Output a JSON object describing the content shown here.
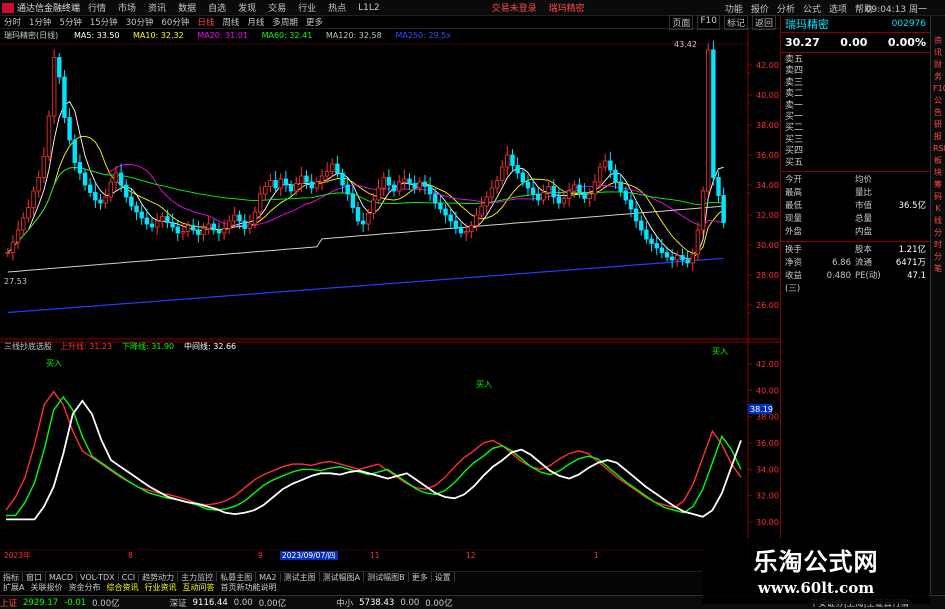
{
  "menubar": {
    "app_title": "通达信金融终端",
    "items": [
      "行情",
      "市场",
      "资讯",
      "数据",
      "自选",
      "发现",
      "交易",
      "行业",
      "热点",
      "L1L2"
    ],
    "center_items": [
      "交易未登录",
      "瑞玛精密"
    ],
    "right_items": [
      "功能",
      "报价",
      "分析",
      "公式",
      "选项",
      "帮助",
      "09:04:13 周一"
    ]
  },
  "toolbar": {
    "periods": [
      "分时",
      "1分钟",
      "5分钟",
      "15分钟",
      "30分钟",
      "60分钟",
      "日线",
      "周线",
      "月线",
      "多周期",
      "更多"
    ],
    "active_period": "日线",
    "right_buttons": [
      "页面",
      "F10",
      "标记",
      "返回"
    ]
  },
  "main_chart": {
    "title": "瑞玛精密(日线)",
    "ma_legend": [
      {
        "label": "MA5: 33.50",
        "color": "#ffffff"
      },
      {
        "label": "MA10: 32.32",
        "color": "#ffff00"
      },
      {
        "label": "MA20: 31.01",
        "color": "#ff00ff"
      },
      {
        "label": "MA60: 32.41",
        "color": "#00ff00"
      },
      {
        "label": "MA120: 32.58",
        "color": "#c0c0c0"
      },
      {
        "label": "MA250: 29.5x",
        "color": "#3050ff"
      }
    ],
    "y_ticks": [
      "42.00",
      "40.00",
      "38.00",
      "36.00",
      "34.00",
      "32.00",
      "30.00",
      "28.00",
      "26.00"
    ],
    "high_label": "43.42",
    "low_label": "27.53"
  },
  "sub_chart": {
    "title": "三线抄底选股",
    "legend": [
      {
        "label": "上升线: 31.23",
        "color": "#ff3030"
      },
      {
        "label": "下降线: 31.90",
        "color": "#00ff00"
      },
      {
        "label": "中间线: 32.66",
        "color": "#ffffff"
      }
    ],
    "y_ticks": [
      "42.00",
      "40.00",
      "38.00",
      "36.00",
      "34.00",
      "32.00",
      "30.00"
    ],
    "current_value": "38.19",
    "signal_labels": [
      "买入",
      "买入",
      "买入"
    ],
    "date_labels": [
      "2023年",
      "8",
      "9",
      "2023/09/07/四",
      "11",
      "12",
      "1"
    ]
  },
  "quote": {
    "name": "瑞玛精密",
    "code": "002976",
    "price": "30.27",
    "change": "0.00",
    "change_pct": "0.00%",
    "orderbook": [
      "卖五",
      "卖四",
      "卖三",
      "卖二",
      "卖一",
      "买一",
      "买二",
      "买三",
      "买四",
      "买五"
    ],
    "stats": [
      {
        "l": "今开",
        "v1": "",
        "l2": "均价",
        "v2": ""
      },
      {
        "l": "最高",
        "v1": "",
        "l2": "量比",
        "v2": ""
      },
      {
        "l": "最低",
        "v1": "",
        "l2": "市值",
        "v2": "36.5亿"
      },
      {
        "l": "现量",
        "v1": "",
        "l2": "总量",
        "v2": ""
      },
      {
        "l": "外盘",
        "v1": "",
        "l2": "内盘",
        "v2": ""
      }
    ],
    "stats2": [
      {
        "l": "换手",
        "v1": "",
        "l2": "股本",
        "v2": "1.21亿"
      },
      {
        "l": "净资",
        "v1": "6.86",
        "l2": "流通",
        "v2": "6471万"
      },
      {
        "l": "收益(三)",
        "v1": "0.480",
        "l2": "PE(动)",
        "v2": "47.1"
      }
    ]
  },
  "vtabs": [
    "资",
    "讯",
    "财",
    "务",
    "F10",
    "公",
    "告",
    "研",
    "报",
    "RSI",
    "板",
    "块",
    "筹",
    "码",
    "K",
    "线",
    "分",
    "时",
    "分",
    "笔"
  ],
  "tabs": [
    "指标",
    "窗口",
    "MACD",
    "VOL-TDX",
    "CCI",
    "趋势动力",
    "主力监控",
    "私募主图",
    "MA2",
    "测试主图",
    "测试幅图A",
    "测试幅图B",
    "更多",
    "设置"
  ],
  "tabs2": [
    "扩展A",
    "关联报价",
    "资金分布",
    "综合资讯",
    "行业资讯",
    "互动问答",
    "首页新功能说明"
  ],
  "statusbar": {
    "idx1_name": "上证",
    "idx1_val": "2929.17",
    "idx1_chg": "-0.01",
    "idx1_amt": "0.00亿",
    "idx2_name": "深证",
    "idx2_val": "9116.44",
    "idx2_chg": "0.00",
    "idx2_amt": "0.00亿",
    "idx3_name": "中小",
    "idx3_val": "5738.43",
    "idx3_chg": "0.00",
    "idx3_amt": "0.00亿",
    "right_text": "平安证券|上海|上证云行情"
  },
  "watermark": {
    "line1": "乐淘公式网",
    "line2": "www.60lt.com"
  },
  "colors": {
    "up": "#ff3030",
    "down": "#00e5ff",
    "grid": "#8b0000",
    "accent": "#00e5ff"
  }
}
